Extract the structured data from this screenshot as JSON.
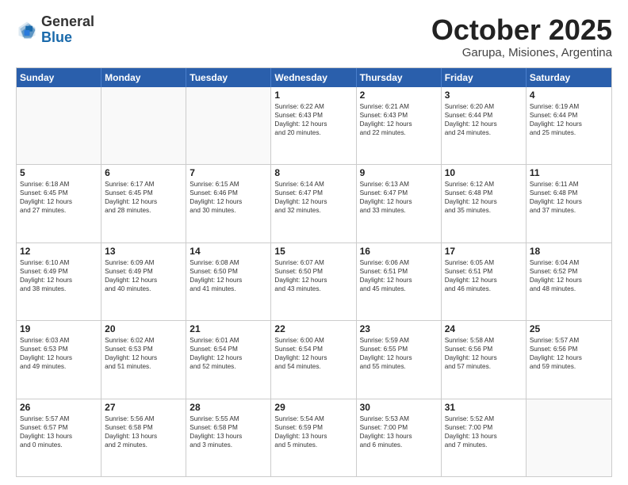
{
  "header": {
    "logo_general": "General",
    "logo_blue": "Blue",
    "month_title": "October 2025",
    "subtitle": "Garupa, Misiones, Argentina"
  },
  "days_of_week": [
    "Sunday",
    "Monday",
    "Tuesday",
    "Wednesday",
    "Thursday",
    "Friday",
    "Saturday"
  ],
  "rows": [
    [
      {
        "day": "",
        "text": ""
      },
      {
        "day": "",
        "text": ""
      },
      {
        "day": "",
        "text": ""
      },
      {
        "day": "1",
        "text": "Sunrise: 6:22 AM\nSunset: 6:43 PM\nDaylight: 12 hours\nand 20 minutes."
      },
      {
        "day": "2",
        "text": "Sunrise: 6:21 AM\nSunset: 6:43 PM\nDaylight: 12 hours\nand 22 minutes."
      },
      {
        "day": "3",
        "text": "Sunrise: 6:20 AM\nSunset: 6:44 PM\nDaylight: 12 hours\nand 24 minutes."
      },
      {
        "day": "4",
        "text": "Sunrise: 6:19 AM\nSunset: 6:44 PM\nDaylight: 12 hours\nand 25 minutes."
      }
    ],
    [
      {
        "day": "5",
        "text": "Sunrise: 6:18 AM\nSunset: 6:45 PM\nDaylight: 12 hours\nand 27 minutes."
      },
      {
        "day": "6",
        "text": "Sunrise: 6:17 AM\nSunset: 6:45 PM\nDaylight: 12 hours\nand 28 minutes."
      },
      {
        "day": "7",
        "text": "Sunrise: 6:15 AM\nSunset: 6:46 PM\nDaylight: 12 hours\nand 30 minutes."
      },
      {
        "day": "8",
        "text": "Sunrise: 6:14 AM\nSunset: 6:47 PM\nDaylight: 12 hours\nand 32 minutes."
      },
      {
        "day": "9",
        "text": "Sunrise: 6:13 AM\nSunset: 6:47 PM\nDaylight: 12 hours\nand 33 minutes."
      },
      {
        "day": "10",
        "text": "Sunrise: 6:12 AM\nSunset: 6:48 PM\nDaylight: 12 hours\nand 35 minutes."
      },
      {
        "day": "11",
        "text": "Sunrise: 6:11 AM\nSunset: 6:48 PM\nDaylight: 12 hours\nand 37 minutes."
      }
    ],
    [
      {
        "day": "12",
        "text": "Sunrise: 6:10 AM\nSunset: 6:49 PM\nDaylight: 12 hours\nand 38 minutes."
      },
      {
        "day": "13",
        "text": "Sunrise: 6:09 AM\nSunset: 6:49 PM\nDaylight: 12 hours\nand 40 minutes."
      },
      {
        "day": "14",
        "text": "Sunrise: 6:08 AM\nSunset: 6:50 PM\nDaylight: 12 hours\nand 41 minutes."
      },
      {
        "day": "15",
        "text": "Sunrise: 6:07 AM\nSunset: 6:50 PM\nDaylight: 12 hours\nand 43 minutes."
      },
      {
        "day": "16",
        "text": "Sunrise: 6:06 AM\nSunset: 6:51 PM\nDaylight: 12 hours\nand 45 minutes."
      },
      {
        "day": "17",
        "text": "Sunrise: 6:05 AM\nSunset: 6:51 PM\nDaylight: 12 hours\nand 46 minutes."
      },
      {
        "day": "18",
        "text": "Sunrise: 6:04 AM\nSunset: 6:52 PM\nDaylight: 12 hours\nand 48 minutes."
      }
    ],
    [
      {
        "day": "19",
        "text": "Sunrise: 6:03 AM\nSunset: 6:53 PM\nDaylight: 12 hours\nand 49 minutes."
      },
      {
        "day": "20",
        "text": "Sunrise: 6:02 AM\nSunset: 6:53 PM\nDaylight: 12 hours\nand 51 minutes."
      },
      {
        "day": "21",
        "text": "Sunrise: 6:01 AM\nSunset: 6:54 PM\nDaylight: 12 hours\nand 52 minutes."
      },
      {
        "day": "22",
        "text": "Sunrise: 6:00 AM\nSunset: 6:54 PM\nDaylight: 12 hours\nand 54 minutes."
      },
      {
        "day": "23",
        "text": "Sunrise: 5:59 AM\nSunset: 6:55 PM\nDaylight: 12 hours\nand 55 minutes."
      },
      {
        "day": "24",
        "text": "Sunrise: 5:58 AM\nSunset: 6:56 PM\nDaylight: 12 hours\nand 57 minutes."
      },
      {
        "day": "25",
        "text": "Sunrise: 5:57 AM\nSunset: 6:56 PM\nDaylight: 12 hours\nand 59 minutes."
      }
    ],
    [
      {
        "day": "26",
        "text": "Sunrise: 5:57 AM\nSunset: 6:57 PM\nDaylight: 13 hours\nand 0 minutes."
      },
      {
        "day": "27",
        "text": "Sunrise: 5:56 AM\nSunset: 6:58 PM\nDaylight: 13 hours\nand 2 minutes."
      },
      {
        "day": "28",
        "text": "Sunrise: 5:55 AM\nSunset: 6:58 PM\nDaylight: 13 hours\nand 3 minutes."
      },
      {
        "day": "29",
        "text": "Sunrise: 5:54 AM\nSunset: 6:59 PM\nDaylight: 13 hours\nand 5 minutes."
      },
      {
        "day": "30",
        "text": "Sunrise: 5:53 AM\nSunset: 7:00 PM\nDaylight: 13 hours\nand 6 minutes."
      },
      {
        "day": "31",
        "text": "Sunrise: 5:52 AM\nSunset: 7:00 PM\nDaylight: 13 hours\nand 7 minutes."
      },
      {
        "day": "",
        "text": ""
      }
    ]
  ]
}
